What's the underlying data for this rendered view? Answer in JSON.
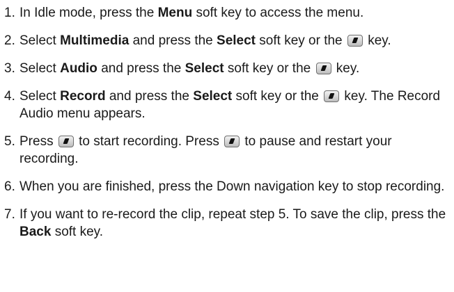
{
  "icons": {
    "select_key": "select-key-icon"
  },
  "steps": [
    {
      "number": "1.",
      "segments": [
        {
          "t": "text",
          "v": "In Idle mode, press the "
        },
        {
          "t": "bold",
          "v": "Menu"
        },
        {
          "t": "text",
          "v": " soft key to access the menu."
        }
      ]
    },
    {
      "number": "2.",
      "segments": [
        {
          "t": "text",
          "v": "Select "
        },
        {
          "t": "bold",
          "v": "Multimedia"
        },
        {
          "t": "text",
          "v": " and press the "
        },
        {
          "t": "bold",
          "v": "Select"
        },
        {
          "t": "text",
          "v": " soft key or the "
        },
        {
          "t": "icon",
          "v": "select-key-icon"
        },
        {
          "t": "text",
          "v": " key."
        }
      ]
    },
    {
      "number": "3.",
      "segments": [
        {
          "t": "text",
          "v": "Select "
        },
        {
          "t": "bold",
          "v": "Audio"
        },
        {
          "t": "text",
          "v": " and press the "
        },
        {
          "t": "bold",
          "v": "Select"
        },
        {
          "t": "text",
          "v": " soft key or the "
        },
        {
          "t": "icon",
          "v": "select-key-icon"
        },
        {
          "t": "text",
          "v": " key."
        }
      ]
    },
    {
      "number": "4.",
      "segments": [
        {
          "t": "text",
          "v": "Select "
        },
        {
          "t": "bold",
          "v": "Record"
        },
        {
          "t": "text",
          "v": " and press the "
        },
        {
          "t": "bold",
          "v": "Select"
        },
        {
          "t": "text",
          "v": " soft key or the "
        },
        {
          "t": "icon",
          "v": "select-key-icon"
        },
        {
          "t": "text",
          "v": " key. The Record Audio menu appears."
        }
      ]
    },
    {
      "number": "5.",
      "segments": [
        {
          "t": "text",
          "v": "Press "
        },
        {
          "t": "icon",
          "v": "select-key-icon"
        },
        {
          "t": "text",
          "v": " to start recording. Press "
        },
        {
          "t": "icon",
          "v": "select-key-icon"
        },
        {
          "t": "text",
          "v": " to pause and restart your recording."
        }
      ]
    },
    {
      "number": "6.",
      "segments": [
        {
          "t": "text",
          "v": "When you are finished, press the Down navigation key to stop recording."
        }
      ]
    },
    {
      "number": "7.",
      "segments": [
        {
          "t": "text",
          "v": "If you want to re-record the clip, repeat step 5. To save the clip, press the "
        },
        {
          "t": "bold",
          "v": "Back"
        },
        {
          "t": "text",
          "v": " soft key."
        }
      ]
    }
  ]
}
